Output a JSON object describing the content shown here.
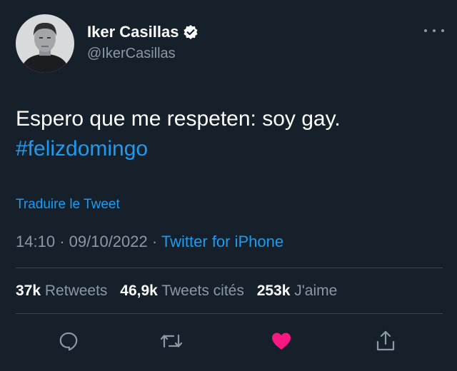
{
  "user": {
    "display_name": "Iker Casillas",
    "handle": "@IkerCasillas",
    "verified": true
  },
  "tweet": {
    "text": "Espero que me respeten: soy gay.",
    "hashtag": "#felizdomingo",
    "translate_label": "Traduire le Tweet",
    "time": "14:10",
    "date": "09/10/2022",
    "separator": "·",
    "source": "Twitter for iPhone"
  },
  "stats": {
    "retweets_count": "37k",
    "retweets_label": "Retweets",
    "quotes_count": "46,9k",
    "quotes_label": "Tweets cités",
    "likes_count": "253k",
    "likes_label": "J'aime"
  },
  "actions": {
    "icons": [
      "reply-icon",
      "retweet-icon",
      "like-icon",
      "share-icon"
    ],
    "liked": true
  },
  "colors": {
    "background": "#15202b",
    "text": "#ffffff",
    "secondary": "#8b98a5",
    "link": "#1d9bf0",
    "like": "#f91880",
    "divider": "#38444d"
  }
}
